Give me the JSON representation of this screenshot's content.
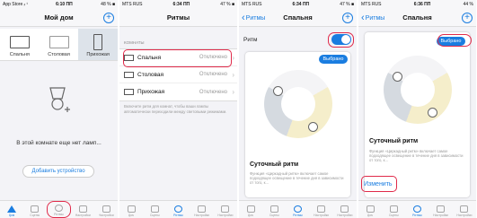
{
  "colors": {
    "accent": "#1a7de0",
    "highlight": "#e02a4a"
  },
  "screens": [
    {
      "status": {
        "left": "App Store ᵢₗ ᵗ",
        "time": "6:10 ПП",
        "right": "48 % ■"
      },
      "title": "Мой дом",
      "rooms": [
        {
          "label": "Спальня",
          "icon": "bed-icon"
        },
        {
          "label": "Столовая",
          "icon": "table-icon"
        },
        {
          "label": "Прихожая",
          "icon": "door-icon"
        }
      ],
      "empty_text": "В этой комнате еще нет ламп...",
      "add_device": "Добавить устройство"
    },
    {
      "status": {
        "left": "MTS RUS",
        "time": "6:34 ПП",
        "right": "47 % ■"
      },
      "title": "Ритмы",
      "section": "КОМНАТЫ",
      "rooms": [
        {
          "label": "Спальня",
          "status": "Отключено"
        },
        {
          "label": "Столовая",
          "status": "Отключено"
        },
        {
          "label": "Прихожая",
          "status": "Отключено"
        }
      ],
      "note": "Включите ритм для комнат, чтобы ваши лампы автоматически переходили между световыми режимами."
    },
    {
      "status": {
        "left": "MTS RUS",
        "time": "6:34 ПП",
        "right": "47 % ■"
      },
      "back": "Ритмы",
      "title": "Спальня",
      "toggle_label": "Ритм",
      "badge": "Выбрано",
      "card_title": "Суточный ритм",
      "card_desc": "Функция «Циркадный ритм» включает самое подходящее освещение в течение дня в зависимости от того, к..."
    },
    {
      "status": {
        "left": "MTS RUS",
        "time": "6:36 ПП",
        "right": "44 %"
      },
      "back": "Ритмы",
      "title": "Спальня",
      "badge": "Выбрано",
      "card_title": "Суточный ритм",
      "card_desc": "Функция «Циркадный ритм» включает самое подходящее освещение в течение дня в зависимости от того, к...",
      "change": "Изменить"
    }
  ],
  "tabs": [
    "Дом",
    "Сцены",
    "Ритмы",
    "Настройки",
    "Настройки"
  ]
}
